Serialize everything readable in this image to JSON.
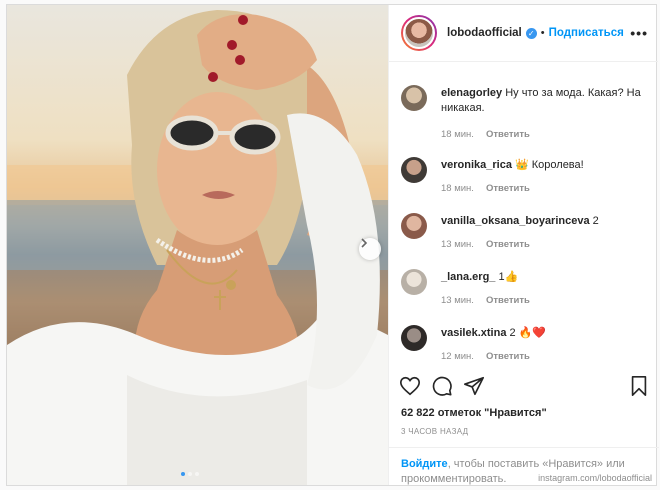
{
  "post": {
    "username": "lobodaofficial",
    "separator": "•",
    "follow_label": "Подписаться",
    "more_label": "•••",
    "verified_mark": "✓",
    "dots": [
      true,
      false,
      false
    ]
  },
  "comments": [
    {
      "user": "elenagorley",
      "text": "Ну что за мода. Какая? На никакая.",
      "time": "18 мин.",
      "reply": "Ответить",
      "avatar_color": "#7a6a5a"
    },
    {
      "user": "veronika_rica",
      "text": "👑 Королева!",
      "time": "18 мин.",
      "reply": "Ответить",
      "avatar_color": "#3f3a36"
    },
    {
      "user": "vanilla_oksana_boyarinceva",
      "text": "2",
      "time": "13 мин.",
      "reply": "Ответить",
      "avatar_color": "#8a5a4a"
    },
    {
      "user": "_lana.erg_",
      "text": "1👍",
      "time": "13 мин.",
      "reply": "Ответить",
      "avatar_color": "#b8b0a6"
    },
    {
      "user": "vasilek.xtina",
      "text": "2 🔥❤️",
      "time": "12 мин.",
      "reply": "Ответить",
      "avatar_color": "#2e2a28"
    }
  ],
  "actions": {
    "like_icon": "heart-icon",
    "comment_icon": "comment-icon",
    "share_icon": "share-icon",
    "save_icon": "bookmark-icon"
  },
  "likes_text": "62 822 отметок \"Нравится\"",
  "time_ago": "3 ЧАСОВ НАЗАД",
  "login": {
    "link": "Войдите",
    "text": ", чтобы поставить «Нравится» или прокомментировать."
  },
  "watermark": "instagram.com/lobodaofficial",
  "colors": {
    "accent": "#0095f6",
    "secondary_text": "#8e8e8e"
  }
}
